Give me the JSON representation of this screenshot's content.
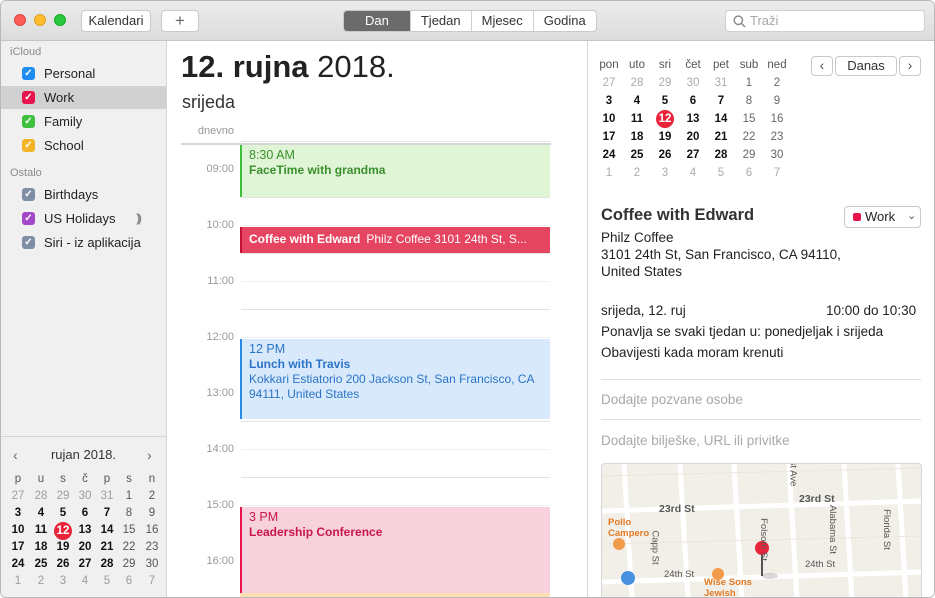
{
  "toolbar": {
    "calendars_button": "Kalendari",
    "add_button": "+",
    "views": [
      "Dan",
      "Tjedan",
      "Mjesec",
      "Godina"
    ],
    "active_view": "Dan",
    "search_placeholder": "Traži"
  },
  "sidebar": {
    "groups": [
      {
        "title": "iCloud",
        "items": [
          {
            "label": "Personal",
            "color": "#1e8cf0",
            "checked": true,
            "selected": false
          },
          {
            "label": "Work",
            "color": "#e8144e",
            "checked": true,
            "selected": true
          },
          {
            "label": "Family",
            "color": "#3fc13f",
            "checked": true,
            "selected": false
          },
          {
            "label": "School",
            "color": "#f4b428",
            "checked": true,
            "selected": false
          }
        ]
      },
      {
        "title": "Ostalo",
        "items": [
          {
            "label": "Birthdays",
            "color": "#7f8fa6",
            "checked": true,
            "selected": false
          },
          {
            "label": "US Holidays",
            "color": "#a348c8",
            "checked": true,
            "selected": false,
            "icon": "broadcast-icon"
          },
          {
            "label": "Siri - iz aplikacija",
            "color": "#7f8fa6",
            "checked": true,
            "selected": false
          }
        ]
      }
    ],
    "mini_calendar": {
      "month_title": "rujan 2018.",
      "weekdays": [
        "p",
        "u",
        "s",
        "č",
        "p",
        "s",
        "n"
      ],
      "weeks": [
        [
          "27",
          "28",
          "29",
          "30",
          "31",
          "1",
          "2"
        ],
        [
          "3",
          "4",
          "5",
          "6",
          "7",
          "8",
          "9"
        ],
        [
          "10",
          "11",
          "12",
          "13",
          "14",
          "15",
          "16"
        ],
        [
          "17",
          "18",
          "19",
          "20",
          "21",
          "22",
          "23"
        ],
        [
          "24",
          "25",
          "26",
          "27",
          "28",
          "29",
          "30"
        ],
        [
          "1",
          "2",
          "3",
          "4",
          "5",
          "6",
          "7"
        ]
      ],
      "today": "12"
    }
  },
  "day_view": {
    "date_bold": "12. rujna",
    "year": "2018.",
    "weekday": "srijeda",
    "allday_label": "dnevno",
    "hours": [
      "09:00",
      "10:00",
      "11:00",
      "12:00",
      "13:00",
      "14:00",
      "15:00",
      "16:00"
    ],
    "events": [
      {
        "time": "8:30 AM",
        "title": "FaceTime with grandma",
        "location": "",
        "color": "#3fc13f",
        "style": "family"
      },
      {
        "time": "",
        "title": "Coffee with Edward",
        "location": "Philz Coffee 3101 24th St, S...",
        "color": "#e8144e",
        "style": "work-selected"
      },
      {
        "time": "12 PM",
        "title": "Lunch with Travis",
        "location": "Kokkari Estiatorio 200 Jackson St, San Francisco, CA  94111, United States",
        "color": "#1e8cf0",
        "style": "personal"
      },
      {
        "time": "3 PM",
        "title": "Leadership Conference",
        "location": "",
        "color": "#e8144e",
        "style": "work"
      }
    ]
  },
  "right_calendar": {
    "weekdays": [
      "pon",
      "uto",
      "sri",
      "čet",
      "pet",
      "sub",
      "ned"
    ],
    "weeks": [
      [
        "27",
        "28",
        "29",
        "30",
        "31",
        "1",
        "2"
      ],
      [
        "3",
        "4",
        "5",
        "6",
        "7",
        "8",
        "9"
      ],
      [
        "10",
        "11",
        "12",
        "13",
        "14",
        "15",
        "16"
      ],
      [
        "17",
        "18",
        "19",
        "20",
        "21",
        "22",
        "23"
      ],
      [
        "24",
        "25",
        "26",
        "27",
        "28",
        "29",
        "30"
      ],
      [
        "1",
        "2",
        "3",
        "4",
        "5",
        "6",
        "7"
      ]
    ],
    "today": "12",
    "today_button": "Danas"
  },
  "inspector": {
    "title": "Coffee with Edward",
    "calendar": "Work",
    "calendar_color": "#e8144e",
    "location_name": "Philz Coffee",
    "address_line1": "3101 24th St, San Francisco, CA  94110,",
    "address_line2": "United States",
    "date": "srijeda, 12. ruj",
    "time_range": "10:00 do 10:30",
    "repeat": "Ponavlja se svaki tjedan u: ponedjeljak i srijeda",
    "alert": "Obavijesti kada moram krenuti",
    "invitees_placeholder": "Dodajte pozvane osobe",
    "notes_placeholder": "Dodajte bilješke, URL ili privitke",
    "map": {
      "labels": [
        "23rd St",
        "23rd St",
        "Pollo Campero",
        "Capp St",
        "Folsom St",
        "Alabama St",
        "Florida St",
        "24th St",
        "24th St",
        "Wise Sons Jewish",
        "st Ave"
      ]
    }
  }
}
